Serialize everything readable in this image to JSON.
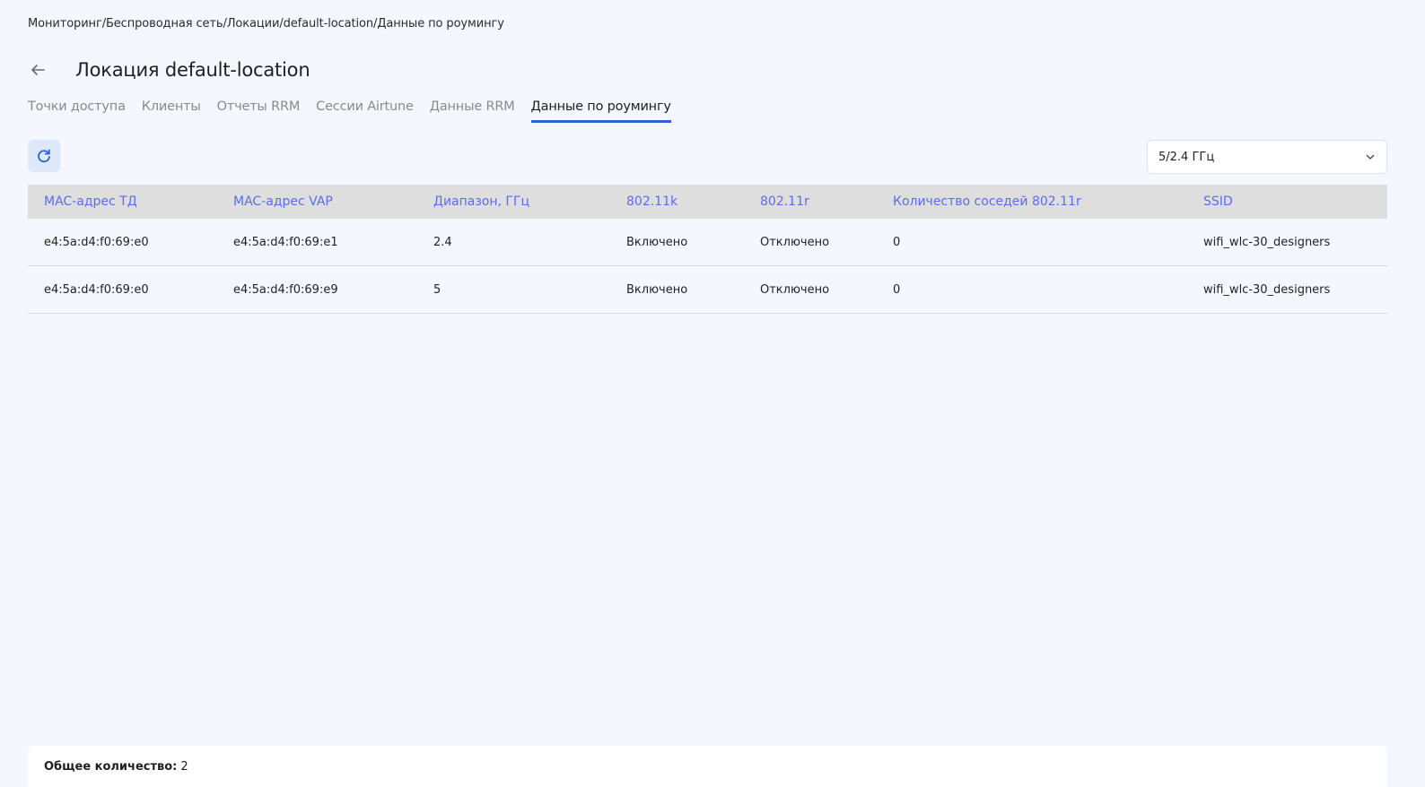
{
  "breadcrumb": {
    "items": [
      "Мониторинг",
      "Беспроводная сеть",
      "Локации",
      "default-location",
      "Данные по роумингу"
    ],
    "separator": "/"
  },
  "header": {
    "title": "Локация default-location"
  },
  "tabs": [
    {
      "label": "Точки доступа",
      "active": false
    },
    {
      "label": "Клиенты",
      "active": false
    },
    {
      "label": "Отчеты RRM",
      "active": false
    },
    {
      "label": "Сессии Airtune",
      "active": false
    },
    {
      "label": "Данные RRM",
      "active": false
    },
    {
      "label": "Данные по роумингу",
      "active": true
    }
  ],
  "toolbar": {
    "refresh_icon": "refresh-icon",
    "band_select": {
      "value": "5/2.4 ГГц",
      "icon": "chevron-down-icon"
    }
  },
  "table": {
    "columns": [
      "MAC-адрес ТД",
      "MAC-адрес VAP",
      "Диапазон, ГГц",
      "802.11k",
      "802.11r",
      "Количество соседей 802.11r",
      "SSID"
    ],
    "rows": [
      {
        "ap_mac": "e4:5a:d4:f0:69:e0",
        "vap_mac": "e4:5a:d4:f0:69:e1",
        "band": "2.4",
        "k": "Включено",
        "r": "Отключено",
        "neighbors": "0",
        "ssid": "wifi_wlc-30_designers"
      },
      {
        "ap_mac": "e4:5a:d4:f0:69:e0",
        "vap_mac": "e4:5a:d4:f0:69:e9",
        "band": "5",
        "k": "Включено",
        "r": "Отключено",
        "neighbors": "0",
        "ssid": "wifi_wlc-30_designers"
      }
    ]
  },
  "footer": {
    "total_label": "Общее количество:",
    "total_value": "2"
  },
  "colors": {
    "accent": "#2b63d6",
    "header_text": "#5b6cf0",
    "header_bg": "#dedede",
    "page_bg": "#f4f7fd"
  }
}
